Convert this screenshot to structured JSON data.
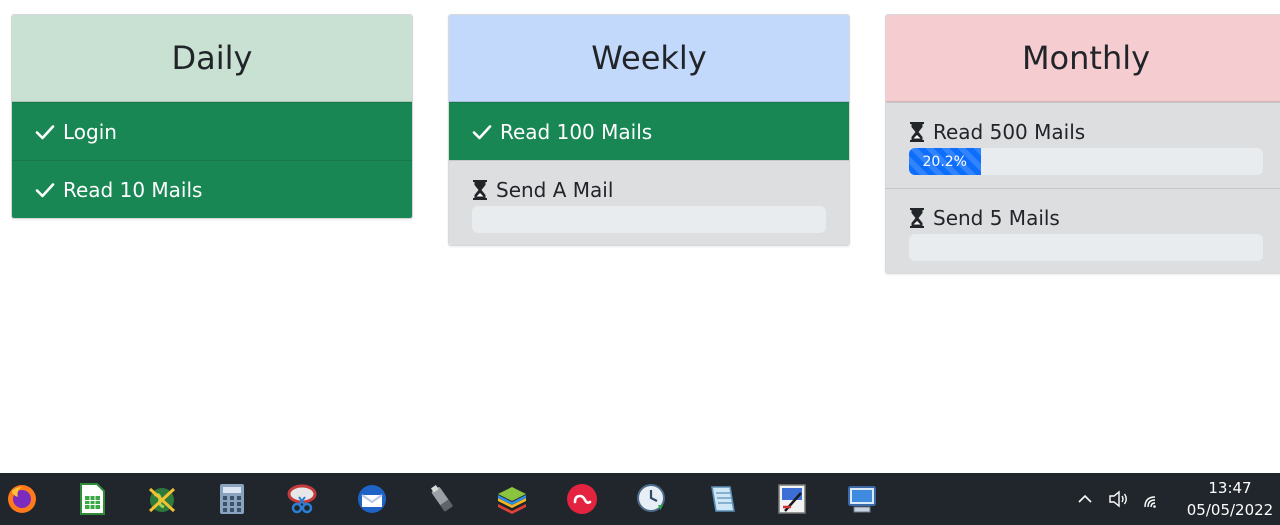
{
  "panels": [
    {
      "title": "Daily",
      "header_color": "#c8e1d3",
      "tasks": [
        {
          "label": "Login",
          "status": "done"
        },
        {
          "label": "Read 10 Mails",
          "status": "done"
        }
      ]
    },
    {
      "title": "Weekly",
      "header_color": "#c3d9fb",
      "tasks": [
        {
          "label": "Read 100 Mails",
          "status": "done"
        },
        {
          "label": "Send A Mail",
          "status": "pending",
          "progress": 0
        }
      ]
    },
    {
      "title": "Monthly",
      "header_color": "#f5cdd0",
      "tasks": [
        {
          "label": "Read 500 Mails",
          "status": "pending",
          "progress": 20.2,
          "progress_label": "20.2%"
        },
        {
          "label": "Send 5 Mails",
          "status": "pending",
          "progress": 0
        }
      ]
    }
  ],
  "colors": {
    "done": "#198754",
    "pending": "#dddee0",
    "progress_fill": "#0d6efd",
    "progress_track": "#e9ecef",
    "taskbar": "#20262c"
  },
  "taskbar": {
    "apps": [
      "firefox-icon",
      "libreoffice-calc-icon",
      "globe-app-icon",
      "calculator-icon",
      "snipping-tool-icon",
      "thunderbird-icon",
      "usb-drive-icon",
      "bluestacks-icon",
      "adobe-creative-cloud-icon",
      "download-clock-icon",
      "notepad-icon",
      "paint-icon",
      "remote-desktop-icon"
    ],
    "tray": [
      "chevron-up-icon",
      "volume-icon",
      "wifi-icon"
    ],
    "time": "13:47",
    "date": "05/05/2022"
  }
}
